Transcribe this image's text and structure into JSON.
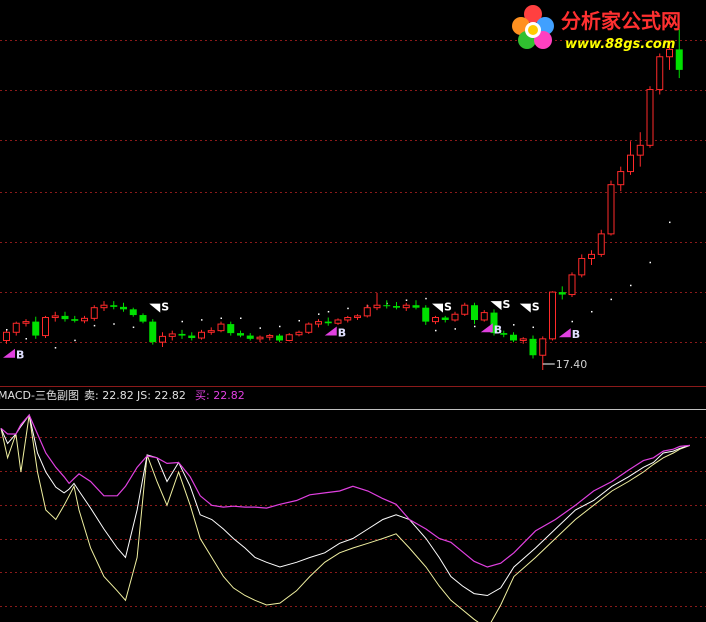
{
  "colors": {
    "background": "#000000",
    "grid": "#8b1a1a",
    "up": "#ff2a2a",
    "down": "#00e000",
    "flat_tick": "#e0e0e0",
    "magenta": "#e040e0",
    "white": "#ffffff",
    "yellow_line": "#f0f0a0",
    "logo_red": "#ff3030",
    "logo_yellow": "#ffff00"
  },
  "logo": {
    "name": "分析家公式网",
    "url": "www.88gs.com"
  },
  "price_label": "17.40",
  "signal_labels": {
    "buy": "B",
    "sell": "S"
  },
  "indicator_header": {
    "name": "MACD-三色副图",
    "sell_label": "卖: 22.82",
    "js_label": "JS: 22.82",
    "buy_label": "买: 22.82"
  },
  "chart_data": {
    "type": "candlestick",
    "candles": [
      [
        21.0,
        22.2,
        20.6,
        22.0
      ],
      [
        22.0,
        23.3,
        21.6,
        23.1
      ],
      [
        23.1,
        23.6,
        22.7,
        23.3
      ],
      [
        23.3,
        23.9,
        21.2,
        21.6
      ],
      [
        21.6,
        24.0,
        21.3,
        23.8
      ],
      [
        23.8,
        24.5,
        23.3,
        24.0
      ],
      [
        24.0,
        24.5,
        23.3,
        23.6
      ],
      [
        23.6,
        24.0,
        23.2,
        23.4
      ],
      [
        23.4,
        24.0,
        23.1,
        23.7
      ],
      [
        23.7,
        25.3,
        23.4,
        25.0
      ],
      [
        25.0,
        25.8,
        24.6,
        25.3
      ],
      [
        25.3,
        25.8,
        24.8,
        25.1
      ],
      [
        25.1,
        25.6,
        24.5,
        24.8
      ],
      [
        24.8,
        25.0,
        23.9,
        24.1
      ],
      [
        24.1,
        24.3,
        23.1,
        23.3
      ],
      [
        23.3,
        23.6,
        20.5,
        20.8
      ],
      [
        20.8,
        22.0,
        20.2,
        21.5
      ],
      [
        21.5,
        22.2,
        21.0,
        21.8
      ],
      [
        21.8,
        22.3,
        21.2,
        21.6
      ],
      [
        21.6,
        22.0,
        21.0,
        21.3
      ],
      [
        21.3,
        22.3,
        21.1,
        22.0
      ],
      [
        22.0,
        22.6,
        21.7,
        22.2
      ],
      [
        22.2,
        23.3,
        22.0,
        23.0
      ],
      [
        23.0,
        23.3,
        21.6,
        21.9
      ],
      [
        21.9,
        22.2,
        21.4,
        21.6
      ],
      [
        21.6,
        21.9,
        21.0,
        21.2
      ],
      [
        21.2,
        21.6,
        20.8,
        21.4
      ],
      [
        21.4,
        21.8,
        21.0,
        21.6
      ],
      [
        21.6,
        21.8,
        20.8,
        21.0
      ],
      [
        21.0,
        21.9,
        20.9,
        21.7
      ],
      [
        21.7,
        22.2,
        21.5,
        22.0
      ],
      [
        22.0,
        23.2,
        21.8,
        23.0
      ],
      [
        23.0,
        23.6,
        22.6,
        23.3
      ],
      [
        23.3,
        23.8,
        22.8,
        23.1
      ],
      [
        23.1,
        23.7,
        22.9,
        23.5
      ],
      [
        23.5,
        24.0,
        23.2,
        23.8
      ],
      [
        23.8,
        24.2,
        23.5,
        24.0
      ],
      [
        24.0,
        25.4,
        23.8,
        25.0
      ],
      [
        25.0,
        26.8,
        24.7,
        25.3
      ],
      [
        25.3,
        25.9,
        24.9,
        25.2
      ],
      [
        25.2,
        25.7,
        24.8,
        25.0
      ],
      [
        25.0,
        25.6,
        24.6,
        25.3
      ],
      [
        25.3,
        25.9,
        24.8,
        25.0
      ],
      [
        25.0,
        25.3,
        22.9,
        23.3
      ],
      [
        23.3,
        24.0,
        23.0,
        23.8
      ],
      [
        23.8,
        24.0,
        23.2,
        23.5
      ],
      [
        23.5,
        24.5,
        23.3,
        24.2
      ],
      [
        24.2,
        25.6,
        24.0,
        25.3
      ],
      [
        25.3,
        25.6,
        23.0,
        23.5
      ],
      [
        23.5,
        24.7,
        23.3,
        24.4
      ],
      [
        24.4,
        24.8,
        21.6,
        21.9
      ],
      [
        21.9,
        22.2,
        21.4,
        21.7
      ],
      [
        21.7,
        22.0,
        20.8,
        21.0
      ],
      [
        21.0,
        21.4,
        20.6,
        21.2
      ],
      [
        21.2,
        21.6,
        18.8,
        19.2
      ],
      [
        19.2,
        21.5,
        17.4,
        21.2
      ],
      [
        21.2,
        27.0,
        21.0,
        26.9
      ],
      [
        26.9,
        27.6,
        26.0,
        26.6
      ],
      [
        26.6,
        29.3,
        26.3,
        29.0
      ],
      [
        29.0,
        31.5,
        28.7,
        31.0
      ],
      [
        31.0,
        32.0,
        30.2,
        31.5
      ],
      [
        31.5,
        34.5,
        31.2,
        34.0
      ],
      [
        34.0,
        40.5,
        33.8,
        40.0
      ],
      [
        40.0,
        42.2,
        39.2,
        41.6
      ],
      [
        41.6,
        45.3,
        41.2,
        43.6
      ],
      [
        43.6,
        46.4,
        42.2,
        44.8
      ],
      [
        44.8,
        52.0,
        44.5,
        51.6
      ],
      [
        51.6,
        56.0,
        51.0,
        55.6
      ],
      [
        55.6,
        57.6,
        54.0,
        56.5
      ],
      [
        56.5,
        59.0,
        53.0,
        54.0
      ]
    ],
    "dots": [
      [
        0,
        22.4
      ],
      [
        2,
        21.3
      ],
      [
        5,
        20.2
      ],
      [
        7,
        21.1
      ],
      [
        9,
        22.9
      ],
      [
        11,
        23.1
      ],
      [
        13,
        22.7
      ],
      [
        15,
        22.7
      ],
      [
        18,
        23.4
      ],
      [
        20,
        23.6
      ],
      [
        22,
        23.8
      ],
      [
        24,
        23.8
      ],
      [
        26,
        22.6
      ],
      [
        28,
        22.8
      ],
      [
        30,
        23.5
      ],
      [
        32,
        24.3
      ],
      [
        33,
        24.6
      ],
      [
        35,
        25.0
      ],
      [
        37,
        25.3
      ],
      [
        39,
        25.6
      ],
      [
        41,
        26.0
      ],
      [
        43,
        26.2
      ],
      [
        44,
        22.3
      ],
      [
        46,
        22.5
      ],
      [
        48,
        22.8
      ],
      [
        50,
        23.1
      ],
      [
        52,
        23.0
      ],
      [
        54,
        22.7
      ],
      [
        56,
        22.8
      ],
      [
        58,
        23.4
      ],
      [
        60,
        24.6
      ],
      [
        62,
        26.1
      ],
      [
        64,
        27.8
      ],
      [
        66,
        30.6
      ],
      [
        68,
        35.5
      ]
    ],
    "buy_signals": [
      {
        "i": 0,
        "y": 18.9
      },
      {
        "i": 33,
        "y": 21.6
      },
      {
        "i": 49,
        "y": 22.0
      },
      {
        "i": 57,
        "y": 21.4
      }
    ],
    "sell_signals": [
      {
        "i": 15,
        "y": 25.5
      },
      {
        "i": 44,
        "y": 25.5
      },
      {
        "i": 50,
        "y": 25.8
      },
      {
        "i": 53,
        "y": 25.5
      }
    ],
    "min_marker": {
      "i": 55,
      "value": 17.4
    },
    "indicator": {
      "magenta": [
        [
          0,
          0.86
        ],
        [
          4,
          0.8
        ],
        [
          9,
          0.8
        ],
        [
          12,
          0.9
        ],
        [
          17,
          1.0
        ],
        [
          22,
          0.8
        ],
        [
          27,
          0.6
        ],
        [
          33,
          0.45
        ],
        [
          38,
          0.35
        ],
        [
          41,
          0.28
        ],
        [
          44,
          0.33
        ],
        [
          47,
          0.38
        ],
        [
          54,
          0.3
        ],
        [
          62,
          0.15
        ],
        [
          70,
          0.15
        ],
        [
          75,
          0.25
        ],
        [
          82,
          0.45
        ],
        [
          88,
          0.57
        ],
        [
          94,
          0.55
        ],
        [
          100,
          0.49
        ],
        [
          107,
          0.5
        ],
        [
          114,
          0.35
        ],
        [
          120,
          0.15
        ],
        [
          127,
          0.05
        ],
        [
          134,
          0.03
        ],
        [
          140,
          0.04
        ],
        [
          147,
          0.03
        ],
        [
          153,
          0.03
        ],
        [
          160,
          0.02
        ],
        [
          168,
          0.06
        ],
        [
          178,
          0.1
        ],
        [
          186,
          0.16
        ],
        [
          195,
          0.18
        ],
        [
          204,
          0.2
        ],
        [
          212,
          0.25
        ],
        [
          221,
          0.2
        ],
        [
          230,
          0.12
        ],
        [
          238,
          0.06
        ],
        [
          246,
          -0.1
        ],
        [
          256,
          -0.2
        ],
        [
          264,
          -0.3
        ],
        [
          271,
          -0.34
        ],
        [
          278,
          -0.44
        ],
        [
          285,
          -0.54
        ],
        [
          293,
          -0.6
        ],
        [
          301,
          -0.56
        ],
        [
          309,
          -0.45
        ],
        [
          322,
          -0.22
        ],
        [
          334,
          -0.1
        ],
        [
          346,
          0.05
        ],
        [
          357,
          0.2
        ],
        [
          368,
          0.3
        ],
        [
          378,
          0.42
        ],
        [
          387,
          0.52
        ],
        [
          393,
          0.55
        ],
        [
          399,
          0.62
        ],
        [
          405,
          0.64
        ],
        [
          409,
          0.67
        ],
        [
          415,
          0.68
        ]
      ],
      "white": [
        [
          0,
          0.86
        ],
        [
          4,
          0.7
        ],
        [
          9,
          0.8
        ],
        [
          12,
          0.88
        ],
        [
          17,
          1.0
        ],
        [
          22,
          0.6
        ],
        [
          27,
          0.4
        ],
        [
          33,
          0.24
        ],
        [
          38,
          0.18
        ],
        [
          41,
          0.22
        ],
        [
          44,
          0.28
        ],
        [
          47,
          0.2
        ],
        [
          54,
          0.02
        ],
        [
          62,
          -0.2
        ],
        [
          70,
          -0.4
        ],
        [
          75,
          -0.5
        ],
        [
          82,
          0.0
        ],
        [
          88,
          0.58
        ],
        [
          94,
          0.55
        ],
        [
          100,
          0.3
        ],
        [
          107,
          0.5
        ],
        [
          114,
          0.25
        ],
        [
          120,
          -0.05
        ],
        [
          127,
          -0.1
        ],
        [
          134,
          -0.2
        ],
        [
          140,
          -0.3
        ],
        [
          147,
          -0.4
        ],
        [
          153,
          -0.5
        ],
        [
          160,
          -0.55
        ],
        [
          168,
          -0.6
        ],
        [
          178,
          -0.55
        ],
        [
          186,
          -0.5
        ],
        [
          195,
          -0.45
        ],
        [
          204,
          -0.35
        ],
        [
          212,
          -0.3
        ],
        [
          221,
          -0.2
        ],
        [
          230,
          -0.1
        ],
        [
          238,
          -0.05
        ],
        [
          246,
          -0.1
        ],
        [
          256,
          -0.3
        ],
        [
          264,
          -0.5
        ],
        [
          271,
          -0.7
        ],
        [
          278,
          -0.8
        ],
        [
          285,
          -0.88
        ],
        [
          293,
          -0.9
        ],
        [
          301,
          -0.82
        ],
        [
          309,
          -0.6
        ],
        [
          322,
          -0.4
        ],
        [
          334,
          -0.2
        ],
        [
          346,
          0.0
        ],
        [
          357,
          0.1
        ],
        [
          368,
          0.25
        ],
        [
          378,
          0.35
        ],
        [
          387,
          0.45
        ],
        [
          393,
          0.5
        ],
        [
          399,
          0.6
        ],
        [
          405,
          0.62
        ],
        [
          409,
          0.65
        ],
        [
          415,
          0.68
        ]
      ],
      "yellow": [
        [
          0,
          0.86
        ],
        [
          4,
          0.55
        ],
        [
          9,
          0.8
        ],
        [
          12,
          0.4
        ],
        [
          17,
          1.0
        ],
        [
          22,
          0.4
        ],
        [
          27,
          0.0
        ],
        [
          33,
          -0.1
        ],
        [
          38,
          0.05
        ],
        [
          41,
          0.15
        ],
        [
          44,
          0.25
        ],
        [
          47,
          0.0
        ],
        [
          54,
          -0.4
        ],
        [
          62,
          -0.7
        ],
        [
          70,
          -0.85
        ],
        [
          75,
          -0.95
        ],
        [
          82,
          -0.5
        ],
        [
          88,
          0.58
        ],
        [
          94,
          0.3
        ],
        [
          100,
          0.05
        ],
        [
          107,
          0.4
        ],
        [
          114,
          0.05
        ],
        [
          120,
          -0.3
        ],
        [
          127,
          -0.5
        ],
        [
          134,
          -0.7
        ],
        [
          140,
          -0.82
        ],
        [
          147,
          -0.9
        ],
        [
          153,
          -0.95
        ],
        [
          160,
          -1.0
        ],
        [
          168,
          -0.98
        ],
        [
          178,
          -0.85
        ],
        [
          186,
          -0.7
        ],
        [
          195,
          -0.55
        ],
        [
          204,
          -0.45
        ],
        [
          212,
          -0.4
        ],
        [
          221,
          -0.35
        ],
        [
          230,
          -0.3
        ],
        [
          238,
          -0.25
        ],
        [
          246,
          -0.4
        ],
        [
          256,
          -0.6
        ],
        [
          264,
          -0.8
        ],
        [
          271,
          -0.95
        ],
        [
          278,
          -1.05
        ],
        [
          285,
          -1.15
        ],
        [
          293,
          -1.25
        ],
        [
          301,
          -1.0
        ],
        [
          309,
          -0.7
        ],
        [
          322,
          -0.5
        ],
        [
          334,
          -0.3
        ],
        [
          346,
          -0.1
        ],
        [
          357,
          0.05
        ],
        [
          368,
          0.2
        ],
        [
          378,
          0.3
        ],
        [
          387,
          0.4
        ],
        [
          393,
          0.48
        ],
        [
          399,
          0.55
        ],
        [
          405,
          0.6
        ],
        [
          409,
          0.64
        ],
        [
          415,
          0.68
        ]
      ]
    }
  }
}
